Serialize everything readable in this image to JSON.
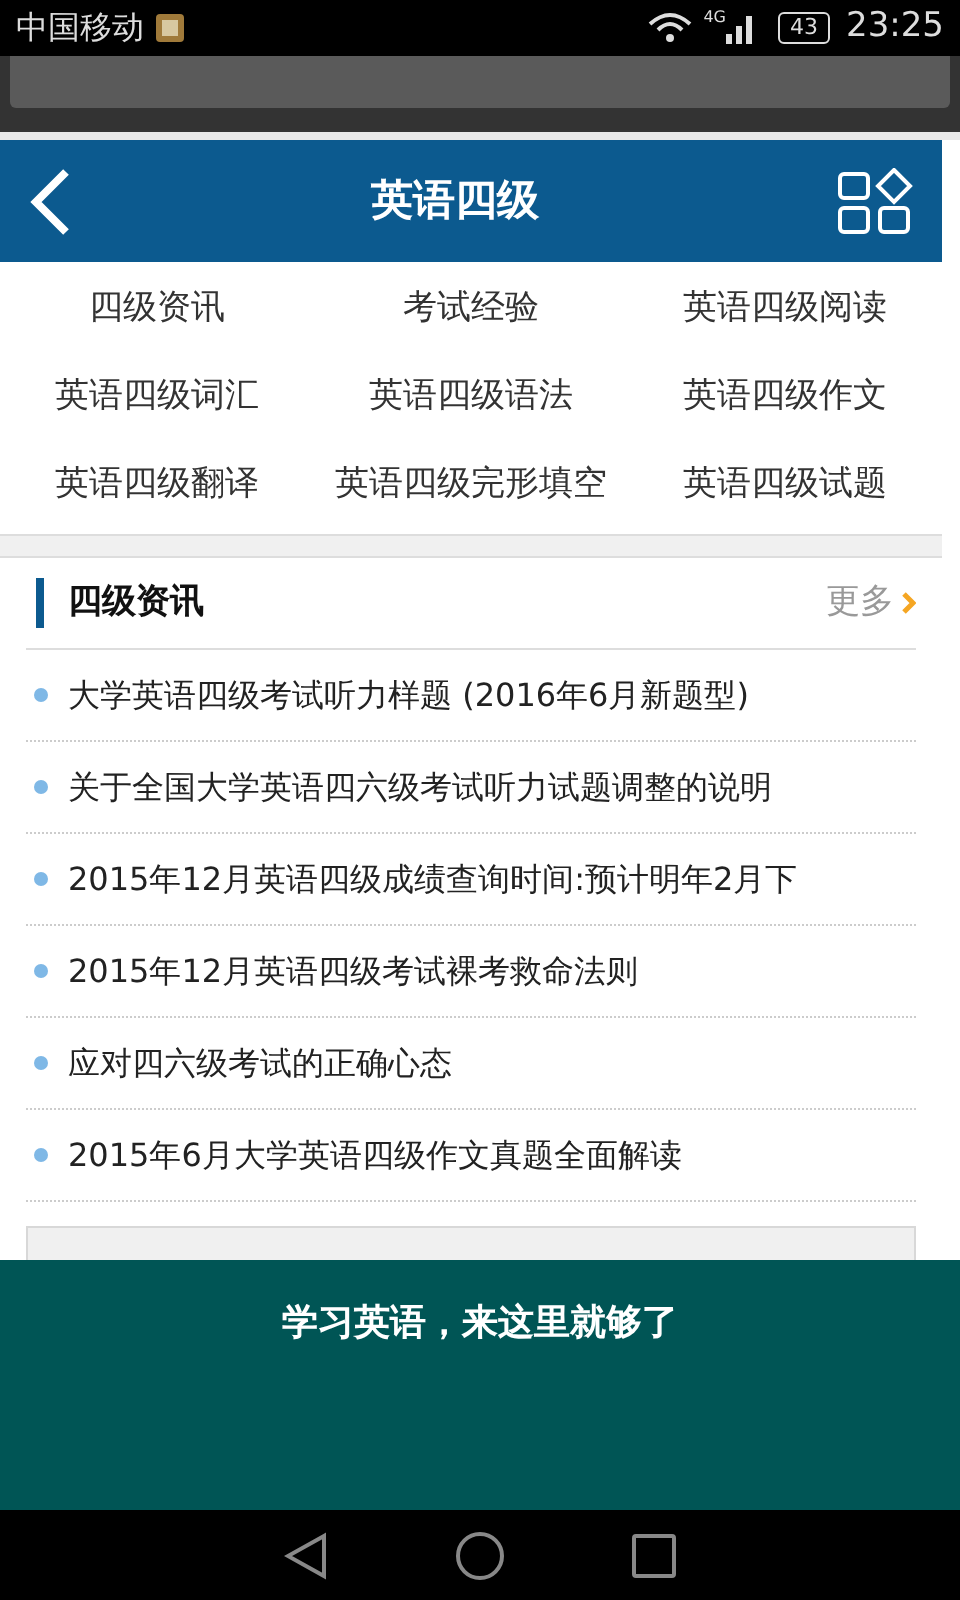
{
  "status_bar": {
    "carrier": "中国移动",
    "network": "4G",
    "battery": "43",
    "time": "23:25"
  },
  "header": {
    "title": "英语四级"
  },
  "categories": [
    "四级资讯",
    "考试经验",
    "英语四级阅读",
    "英语四级词汇",
    "英语四级语法",
    "英语四级作文",
    "英语四级翻译",
    "英语四级完形填空",
    "英语四级试题"
  ],
  "section": {
    "title": "四级资讯",
    "more": "更多",
    "articles": [
      "大学英语四级考试听力样题 (2016年6月新题型)",
      "关于全国大学英语四六级考试听力试题调整的说明",
      "2015年12月英语四级成绩查询时间:预计明年2月下",
      "2015年12月英语四级考试裸考救命法则",
      "应对四六级考试的正确心态",
      "2015年6月大学英语四级作文真题全面解读"
    ]
  },
  "banner": {
    "text": "学习英语，来这里就够了"
  }
}
